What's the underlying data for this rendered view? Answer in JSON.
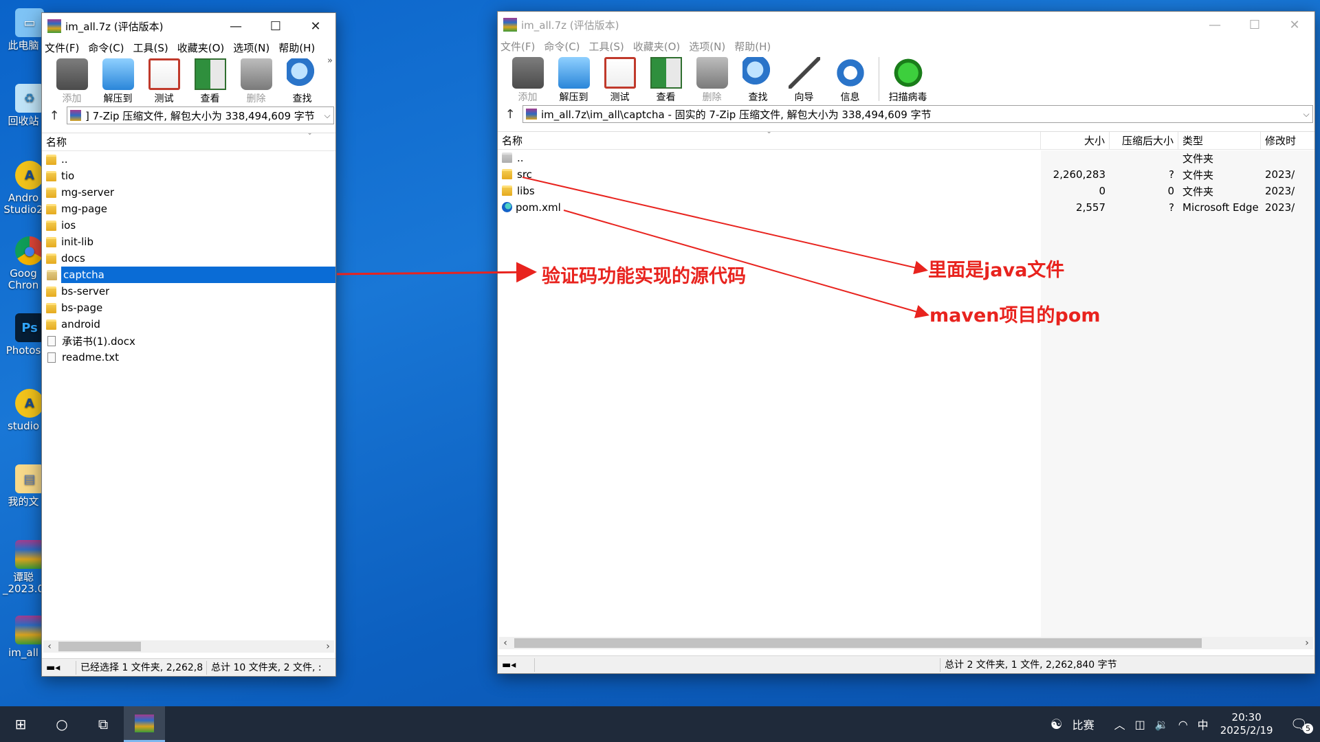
{
  "desktop": {
    "icons": [
      {
        "label": "此电脑"
      },
      {
        "label": "回收站"
      },
      {
        "label": "Andro\nStudio2"
      },
      {
        "label": "Goog\nChron"
      },
      {
        "label": "Photos"
      },
      {
        "label": "studio"
      },
      {
        "label": "我的文"
      },
      {
        "label": "谭聪\n_2023.0"
      },
      {
        "label": "im_all"
      }
    ]
  },
  "left_window": {
    "title": "im_all.7z (评估版本)",
    "menu": [
      "文件(F)",
      "命令(C)",
      "工具(S)",
      "收藏夹(O)",
      "选项(N)",
      "帮助(H)"
    ],
    "toolbar": [
      {
        "label": "添加",
        "icon": "add-icon",
        "disabled": true
      },
      {
        "label": "解压到",
        "icon": "extract-icon",
        "disabled": false
      },
      {
        "label": "测试",
        "icon": "test-icon",
        "disabled": false
      },
      {
        "label": "查看",
        "icon": "view-icon",
        "disabled": false
      },
      {
        "label": "删除",
        "icon": "delete-icon",
        "disabled": true
      },
      {
        "label": "查找",
        "icon": "find-icon",
        "disabled": false
      }
    ],
    "address": "] 7-Zip 压缩文件, 解包大小为 338,494,609 字节",
    "column_name": "名称",
    "rows": [
      {
        "name": "..",
        "type": "folder",
        "selected": false
      },
      {
        "name": "tio",
        "type": "folder",
        "selected": false
      },
      {
        "name": "mg-server",
        "type": "folder",
        "selected": false
      },
      {
        "name": "mg-page",
        "type": "folder",
        "selected": false
      },
      {
        "name": "ios",
        "type": "folder",
        "selected": false
      },
      {
        "name": "init-lib",
        "type": "folder",
        "selected": false
      },
      {
        "name": "docs",
        "type": "folder",
        "selected": false
      },
      {
        "name": "captcha",
        "type": "folder",
        "selected": true
      },
      {
        "name": "bs-server",
        "type": "folder",
        "selected": false
      },
      {
        "name": "bs-page",
        "type": "folder",
        "selected": false
      },
      {
        "name": "android",
        "type": "folder",
        "selected": false
      },
      {
        "name": "承诺书(1).docx",
        "type": "file",
        "selected": false
      },
      {
        "name": "readme.txt",
        "type": "file",
        "selected": false
      }
    ],
    "status_selected": "已经选择 1 文件夹, 2,262,8",
    "status_total": "总计 10 文件夹, 2 文件, :"
  },
  "right_window": {
    "title": "im_all.7z (评估版本)",
    "menu": [
      "文件(F)",
      "命令(C)",
      "工具(S)",
      "收藏夹(O)",
      "选项(N)",
      "帮助(H)"
    ],
    "toolbar": [
      {
        "label": "添加",
        "icon": "add-icon",
        "disabled": true
      },
      {
        "label": "解压到",
        "icon": "extract-icon",
        "disabled": false
      },
      {
        "label": "测试",
        "icon": "test-icon",
        "disabled": false
      },
      {
        "label": "查看",
        "icon": "view-icon",
        "disabled": false
      },
      {
        "label": "删除",
        "icon": "delete-icon",
        "disabled": true
      },
      {
        "label": "查找",
        "icon": "find-icon",
        "disabled": false
      },
      {
        "label": "向导",
        "icon": "wizard-icon",
        "disabled": false
      },
      {
        "label": "信息",
        "icon": "info-icon",
        "disabled": false
      },
      {
        "label": "扫描病毒",
        "icon": "virus-scan-icon",
        "disabled": false
      }
    ],
    "address": "im_all.7z\\im_all\\captcha - 固实的 7-Zip 压缩文件, 解包大小为 338,494,609 字节",
    "columns": {
      "name": "名称",
      "size": "大小",
      "packed": "压缩后大小",
      "type": "类型",
      "modified": "修改时"
    },
    "rows": [
      {
        "name": "..",
        "kind": "parent",
        "size": "",
        "packed": "",
        "type": "文件夹",
        "modified": ""
      },
      {
        "name": "src",
        "kind": "folder",
        "size": "2,260,283",
        "packed": "?",
        "type": "文件夹",
        "modified": "2023/"
      },
      {
        "name": "libs",
        "kind": "folder",
        "size": "0",
        "packed": "0",
        "type": "文件夹",
        "modified": "2023/"
      },
      {
        "name": "pom.xml",
        "kind": "edge",
        "size": "2,557",
        "packed": "?",
        "type": "Microsoft Edge ...",
        "modified": "2023/"
      }
    ],
    "status_total": "总计 2 文件夹, 1 文件, 2,262,840 字节"
  },
  "annotations": {
    "captcha_note": "验证码功能实现的源代码",
    "src_note": "里面是java文件",
    "pom_note": "maven项目的pom",
    "color": "#e8231e"
  },
  "taskbar": {
    "game_label": "比赛",
    "ime": "中",
    "time": "20:30",
    "date": "2025/2/19",
    "notification_count": "5"
  }
}
